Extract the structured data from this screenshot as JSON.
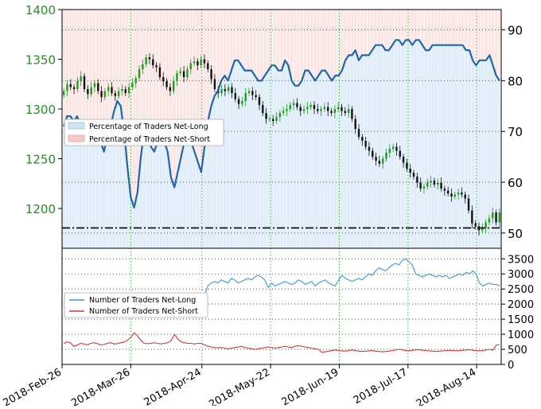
{
  "chart_data": [
    {
      "type": "candlestick",
      "panel": "top",
      "x_tick_labels": [
        "2018-Feb-26",
        "2018-Mar-26",
        "2018-Apr-24",
        "2018-May-22",
        "2018-Jun-19",
        "2018-Jul-17",
        "2018-Aug-14"
      ],
      "x_tick_dates": [
        "2018-02-26",
        "2018-03-26",
        "2018-04-24",
        "2018-05-22",
        "2018-06-19",
        "2018-07-17",
        "2018-08-14"
      ],
      "x_range": [
        "2018-02-26",
        "2018-08-24"
      ],
      "left_axis": {
        "ticks": [
          1200,
          1250,
          1300,
          1350,
          1400
        ],
        "range": [
          1160,
          1400
        ],
        "color": "#2a8a2a"
      },
      "right_axis": {
        "ticks": [
          50,
          60,
          70,
          80,
          90
        ],
        "range": [
          47,
          94
        ]
      },
      "price_close": [
        1318,
        1325,
        1322,
        1320,
        1328,
        1333,
        1320,
        1315,
        1322,
        1326,
        1318,
        1312,
        1318,
        1322,
        1316,
        1313,
        1318,
        1320,
        1316,
        1322,
        1326,
        1331,
        1340,
        1345,
        1352,
        1350,
        1344,
        1342,
        1332,
        1328,
        1322,
        1318,
        1328,
        1336,
        1338,
        1332,
        1340,
        1346,
        1348,
        1344,
        1350,
        1346,
        1340,
        1330,
        1320,
        1316,
        1320,
        1318,
        1322,
        1316,
        1310,
        1305,
        1308,
        1316,
        1318,
        1314,
        1312,
        1304,
        1296,
        1290,
        1290,
        1288,
        1292,
        1296,
        1298,
        1300,
        1304,
        1306,
        1302,
        1298,
        1300,
        1302,
        1304,
        1300,
        1298,
        1300,
        1302,
        1298,
        1296,
        1300,
        1302,
        1298,
        1296,
        1300,
        1290,
        1280,
        1272,
        1268,
        1262,
        1258,
        1252,
        1248,
        1245,
        1250,
        1256,
        1260,
        1262,
        1258,
        1252,
        1246,
        1240,
        1236,
        1232,
        1226,
        1220,
        1222,
        1226,
        1228,
        1224,
        1226,
        1220,
        1218,
        1215,
        1212,
        1214,
        1216,
        1214,
        1210,
        1198,
        1185,
        1182,
        1178,
        1180,
        1186,
        1190,
        1196,
        1186,
        1196
      ],
      "pct_net_long": [
        71,
        73,
        73,
        72,
        73,
        71,
        70,
        69,
        71,
        72,
        70,
        68,
        66,
        69,
        71,
        74,
        76,
        75,
        70,
        63,
        57,
        55,
        58,
        65,
        70,
        69,
        67,
        66,
        68,
        70,
        68,
        66,
        61,
        59,
        62,
        65,
        68,
        70,
        68,
        66,
        64,
        62,
        67,
        72,
        75,
        77,
        78,
        80,
        81,
        80,
        82,
        84,
        84,
        83,
        82,
        82,
        82,
        81,
        80,
        80,
        81,
        82,
        83,
        83,
        82,
        82,
        84,
        83,
        80,
        79,
        79,
        80,
        82,
        82,
        81,
        80,
        81,
        82,
        82,
        81,
        80,
        81,
        81,
        82,
        84,
        85,
        85,
        86,
        84,
        85,
        85,
        85,
        86,
        87,
        87,
        87,
        86,
        86,
        87,
        88,
        88,
        87,
        88,
        88,
        87,
        88,
        88,
        87,
        86,
        86,
        87,
        87,
        87,
        87,
        87,
        87,
        87,
        87,
        87,
        87,
        86,
        86,
        84,
        83,
        84,
        84,
        84,
        85,
        83,
        81,
        80
      ],
      "series": [
        {
          "name": "Percentage of Traders Net-Long",
          "color": "#2066a8",
          "fill": "#cfe4f5"
        },
        {
          "name": "Percentage of Traders Net-Short",
          "color": "#e88f8f",
          "fill": "#f6caca"
        }
      ],
      "reference_line": 51,
      "legend_position": "upper-left",
      "grid": true
    },
    {
      "type": "line",
      "panel": "bottom",
      "x_range": [
        "2018-02-26",
        "2018-08-24"
      ],
      "right_axis": {
        "ticks": [
          0,
          500,
          1000,
          1500,
          2000,
          2500,
          3000,
          3500
        ],
        "range": [
          0,
          3850
        ]
      },
      "series": [
        {
          "name": "Number of Traders Net-Long",
          "color": "#3d95de",
          "values": [
            1600,
            1650,
            1620,
            1600,
            1680,
            1640,
            1600,
            1580,
            1620,
            1660,
            1640,
            1600,
            1610,
            1640,
            1650,
            1630,
            1620,
            1640,
            1650,
            1700,
            1900,
            2100,
            2150,
            2050,
            1900,
            1850,
            1900,
            1950,
            1900,
            1850,
            1880,
            1900,
            2000,
            2050,
            1950,
            1850,
            1800,
            1900,
            2100,
            2200,
            2150,
            2100,
            2300,
            2600,
            2700,
            2750,
            2700,
            2800,
            2750,
            2700,
            2850,
            2800,
            2700,
            2750,
            2800,
            2850,
            2800,
            2900,
            2950,
            2900,
            2800,
            2550,
            2700,
            2600,
            2650,
            2700,
            2750,
            2700,
            2650,
            2700,
            2800,
            2750,
            2650,
            2700,
            2750,
            2600,
            2700,
            2750,
            2800,
            2700,
            2650,
            2600,
            2800,
            2950,
            2850,
            2800,
            2750,
            2800,
            2850,
            2800,
            2900,
            3000,
            2950,
            3100,
            3200,
            3150,
            3100,
            3200,
            3300,
            3350,
            3300,
            3450,
            3500,
            3400,
            3300,
            3000,
            2950,
            2900,
            2950,
            3000,
            2950,
            2900,
            2950,
            2900,
            2950,
            2850,
            2900,
            2950,
            3000,
            2950,
            3050,
            3000,
            3100,
            3000,
            2700,
            2600,
            2650,
            2700,
            2650,
            2650,
            2600
          ],
          "values_note": ""
        },
        {
          "name": "Number of Traders Net-Short",
          "color": "#e03535",
          "values": [
            700,
            750,
            720,
            600,
            640,
            700,
            680,
            650,
            700,
            720,
            690,
            650,
            660,
            700,
            720,
            680,
            690,
            720,
            740,
            800,
            900,
            1050,
            950,
            800,
            700,
            690,
            700,
            720,
            700,
            680,
            700,
            720,
            780,
            1000,
            850,
            750,
            720,
            700,
            700,
            680,
            700,
            700,
            650,
            600,
            580,
            560,
            550,
            560,
            540,
            520,
            540,
            560,
            580,
            600,
            560,
            540,
            520,
            500,
            520,
            540,
            560,
            580,
            560,
            540,
            560,
            580,
            600,
            580,
            560,
            600,
            620,
            600,
            580,
            560,
            540,
            520,
            500,
            400,
            420,
            440,
            460,
            480,
            460,
            450,
            440,
            460,
            480,
            460,
            440,
            430,
            440,
            450,
            460,
            440,
            430,
            420,
            430,
            440,
            460,
            480,
            500,
            480,
            460,
            450,
            470,
            480,
            490,
            470,
            460,
            450,
            440,
            430,
            440,
            450,
            460,
            470,
            460,
            450,
            460,
            470,
            480,
            490,
            470,
            460,
            450,
            460,
            480,
            500,
            470,
            640,
            660
          ]
        }
      ],
      "legend_position": "upper-left",
      "grid": true
    }
  ]
}
